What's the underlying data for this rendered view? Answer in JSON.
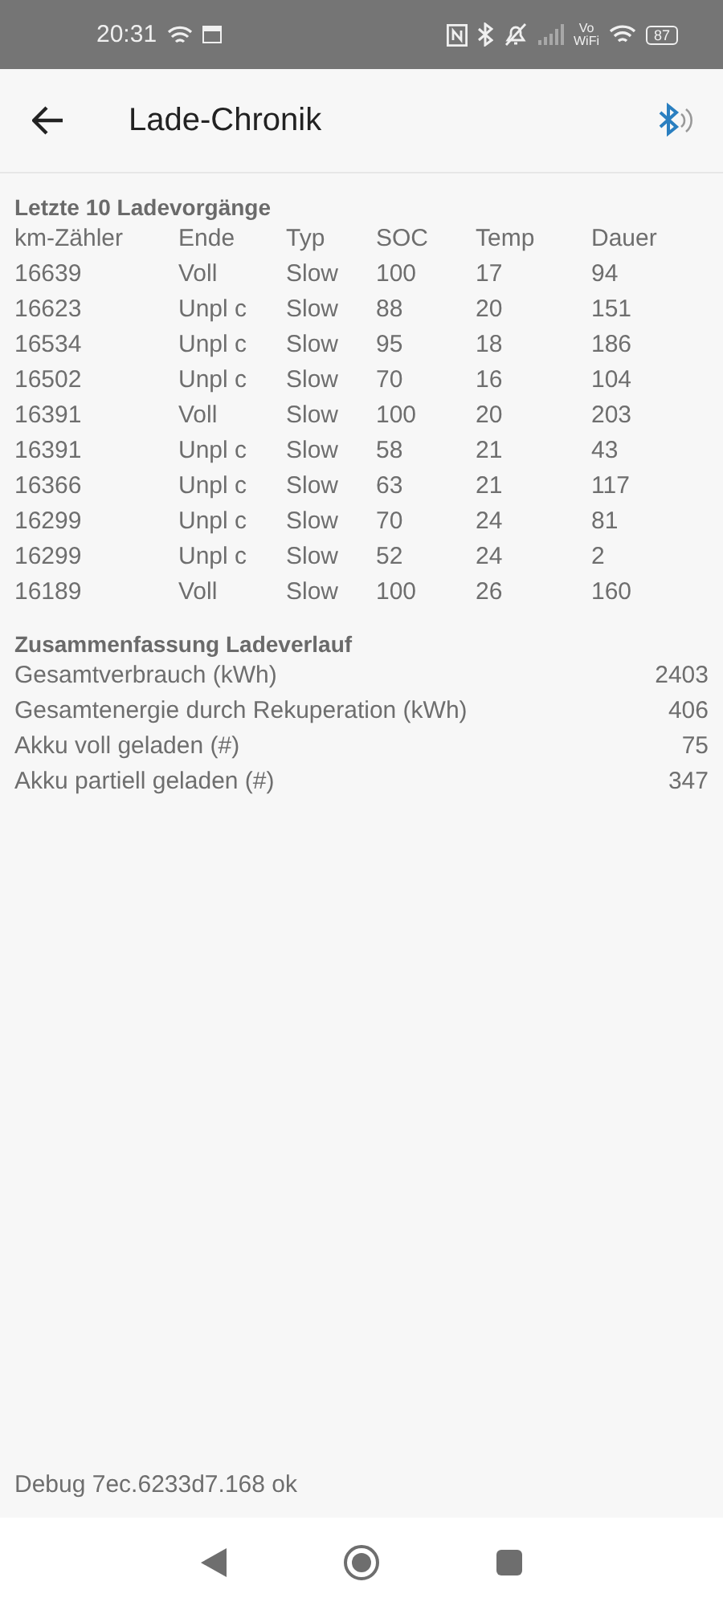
{
  "status_bar": {
    "time": "20:31",
    "volte_top": "Vo",
    "volte_bottom": "WiFi",
    "battery": "87"
  },
  "app_bar": {
    "title": "Lade-Chronik"
  },
  "history": {
    "title": "Letzte 10 Ladevorgänge",
    "columns": [
      "km-Zähler",
      "Ende",
      "Typ",
      "SOC",
      "Temp",
      "Dauer"
    ],
    "rows": [
      [
        "16639",
        "Voll",
        "Slow",
        "100",
        "17",
        "94"
      ],
      [
        "16623",
        "Unpl c",
        "Slow",
        "88",
        "20",
        "151"
      ],
      [
        "16534",
        "Unpl c",
        "Slow",
        "95",
        "18",
        "186"
      ],
      [
        "16502",
        "Unpl c",
        "Slow",
        "70",
        "16",
        "104"
      ],
      [
        "16391",
        "Voll",
        "Slow",
        "100",
        "20",
        "203"
      ],
      [
        "16391",
        "Unpl c",
        "Slow",
        "58",
        "21",
        "43"
      ],
      [
        "16366",
        "Unpl c",
        "Slow",
        "63",
        "21",
        "117"
      ],
      [
        "16299",
        "Unpl c",
        "Slow",
        "70",
        "24",
        "81"
      ],
      [
        "16299",
        "Unpl c",
        "Slow",
        "52",
        "24",
        "2"
      ],
      [
        "16189",
        "Voll",
        "Slow",
        "100",
        "26",
        "160"
      ]
    ]
  },
  "summary": {
    "title": "Zusammenfassung Ladeverlauf",
    "rows": [
      {
        "label": "Gesamtverbrauch (kWh)",
        "value": "2403"
      },
      {
        "label": "Gesamtenergie durch Rekuperation (kWh)",
        "value": "406"
      },
      {
        "label": "Akku voll geladen (#)",
        "value": "75"
      },
      {
        "label": "Akku partiell geladen (#)",
        "value": "347"
      }
    ]
  },
  "footer": {
    "debug": "Debug 7ec.6233d7.168 ok"
  }
}
